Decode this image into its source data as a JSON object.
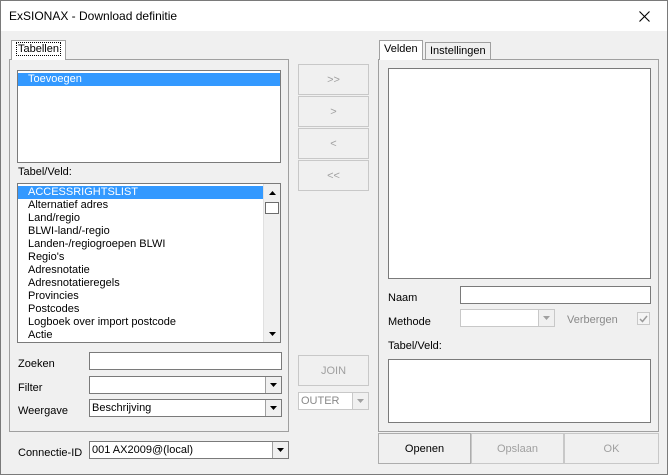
{
  "window": {
    "title": "ExSIONAX - Download definitie"
  },
  "left_tab": {
    "label": "Tabellen"
  },
  "right_tabs": [
    {
      "label": "Velden"
    },
    {
      "label": "Instellingen"
    }
  ],
  "tables_list": {
    "items": [
      "Toevoegen"
    ],
    "selected_index": 0
  },
  "tabel_veld_label": "Tabel/Veld:",
  "field_list": {
    "items": [
      "ACCESSRIGHTSLIST",
      "Alternatief adres",
      "Land/regio",
      "BLWI-land/-regio",
      "Landen-/regiogroepen BLWI",
      "Regio's",
      "Adresnotatie",
      "Adresnotatieregels",
      "Provincies",
      "Postcodes",
      "Logboek over import postcode",
      "Actie"
    ],
    "selected_index": 0
  },
  "search": {
    "label": "Zoeken",
    "value": ""
  },
  "filter": {
    "label": "Filter",
    "value": ""
  },
  "view": {
    "label": "Weergave",
    "value": "Beschrijving"
  },
  "connection": {
    "label": "Connectie-ID",
    "value": "001 AX2009@(local)"
  },
  "move_buttons": {
    "add_all": ">>",
    "add": ">",
    "remove": "<",
    "remove_all": "<<"
  },
  "join": {
    "button": "JOIN",
    "type_value": "OUTER"
  },
  "right_panel": {
    "naam_label": "Naam",
    "naam_value": "",
    "methode_label": "Methode",
    "methode_value": "",
    "verbergen_label": "Verbergen",
    "verbergen_checked": true,
    "tabel_veld_label": "Tabel/Veld:"
  },
  "footer_buttons": {
    "open": "Openen",
    "save": "Opslaan",
    "ok": "OK"
  }
}
